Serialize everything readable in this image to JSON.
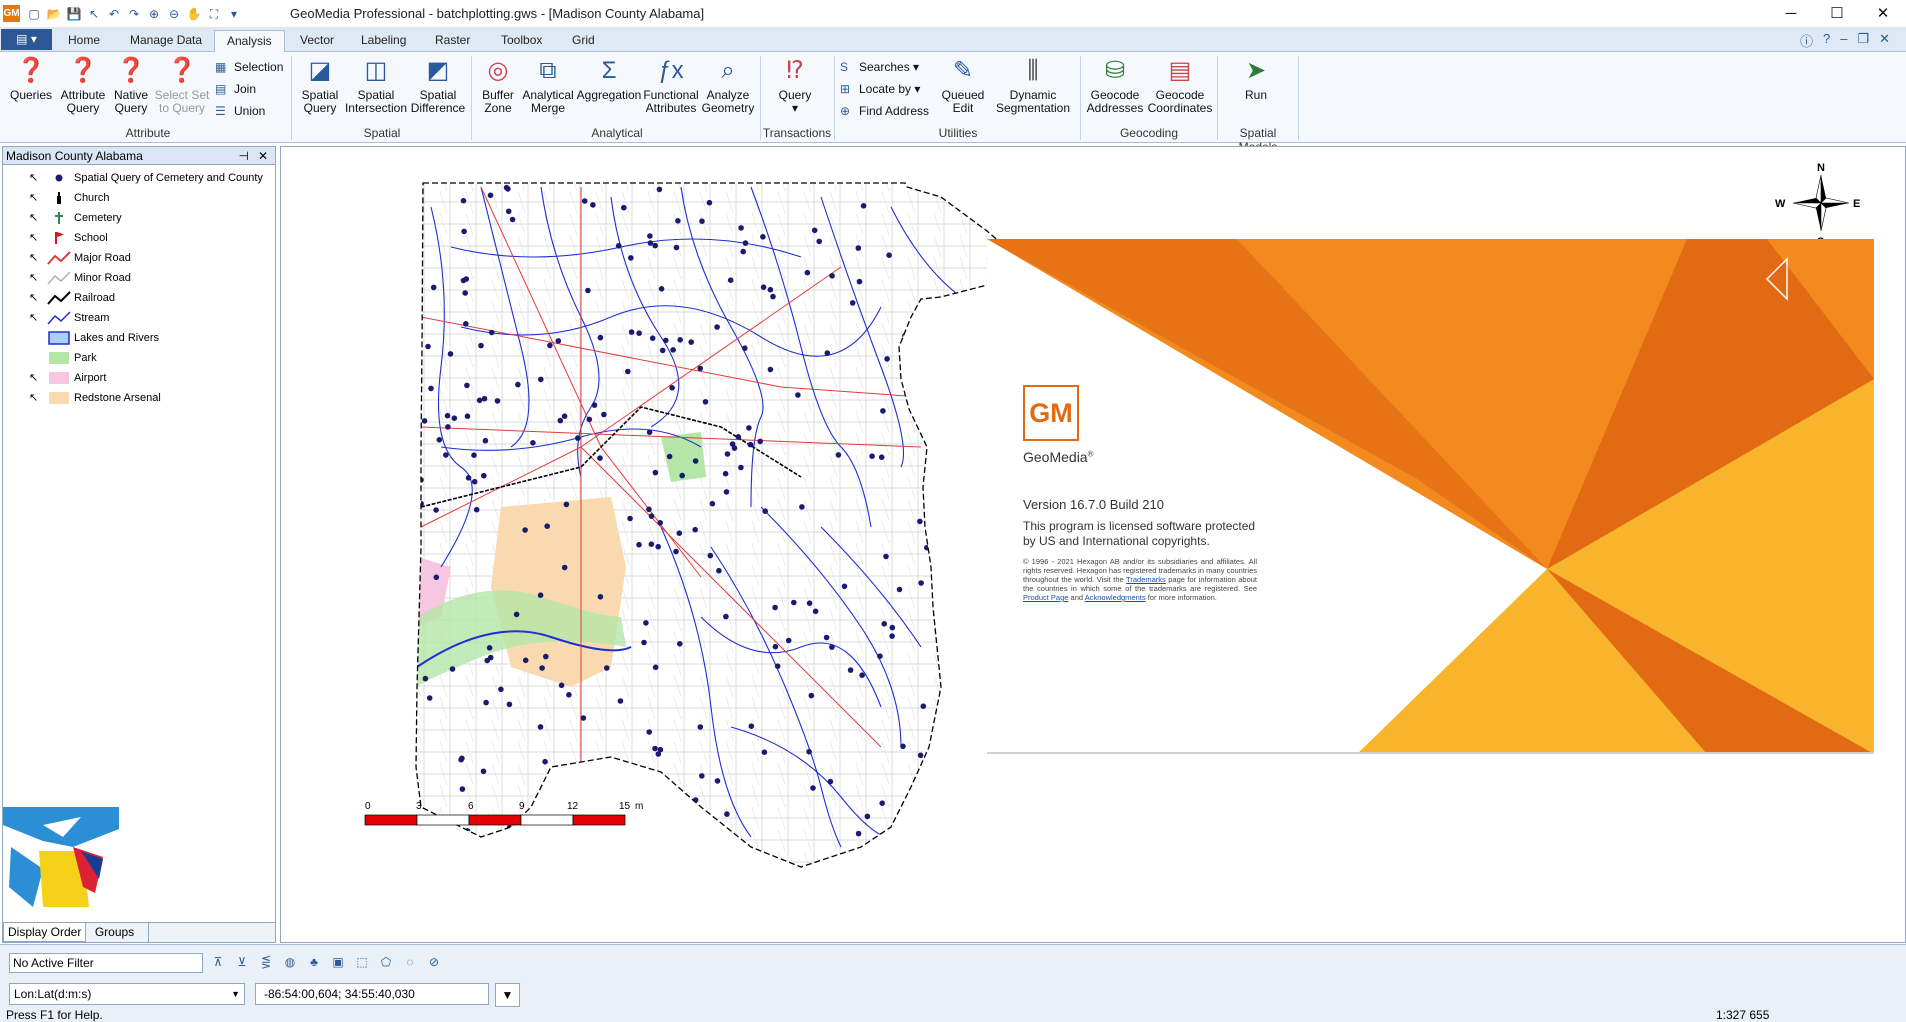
{
  "titlebar": {
    "app_logo": "GM",
    "title": "GeoMedia Professional - batchplotting.gws - [Madison County Alabama]",
    "minimize": "─",
    "maximize": "☐",
    "close": "✕"
  },
  "tabs": {
    "file": "▤ ▾",
    "items": [
      "Home",
      "Manage Data",
      "Analysis",
      "Vector",
      "Labeling",
      "Raster",
      "Toolbox",
      "Grid"
    ]
  },
  "ribbon": {
    "queries": "Queries",
    "attribute_query": [
      "Attribute",
      "Query"
    ],
    "native_query": [
      "Native",
      "Query"
    ],
    "select_set": [
      "Select Set",
      "to Query"
    ],
    "selection": "Selection",
    "join": "Join",
    "union": "Union",
    "spatial_query": [
      "Spatial",
      "Query"
    ],
    "spatial_intersection": [
      "Spatial",
      "Intersection"
    ],
    "spatial_difference": [
      "Spatial",
      "Difference"
    ],
    "buffer_zone": [
      "Buffer",
      "Zone"
    ],
    "analytical_merge": [
      "Analytical",
      "Merge"
    ],
    "aggregation": "Aggregation",
    "functional_attributes": [
      "Functional",
      "Attributes"
    ],
    "analyze_geometry": [
      "Analyze",
      "Geometry"
    ],
    "query": "Query",
    "searches": "Searches ▾",
    "locate_by": "Locate by ▾",
    "find_address": "Find Address",
    "queued_edit": [
      "Queued",
      "Edit"
    ],
    "dynamic_segmentation": [
      "Dynamic",
      "Segmentation"
    ],
    "geocode_addresses": [
      "Geocode",
      "Addresses"
    ],
    "geocode_coordinates": [
      "Geocode",
      "Coordinates"
    ],
    "run": "Run",
    "groups": {
      "attribute": "Attribute",
      "spatial": "Spatial",
      "analytical": "Analytical",
      "transactions": "Transactions",
      "utilities": "Utilities",
      "geocoding": "Geocoding",
      "spatial_models": "Spatial Models"
    }
  },
  "legend_panel": {
    "title": "Madison County Alabama",
    "items": [
      {
        "label": "Spatial Query of Cemetery and County",
        "symbol": "dot",
        "color": "#1a1a6e"
      },
      {
        "label": "Church",
        "symbol": "church",
        "color": "#000000"
      },
      {
        "label": "Cemetery",
        "symbol": "cross",
        "color": "#2e8b57"
      },
      {
        "label": "School",
        "symbol": "flag",
        "color": "#dd1111"
      },
      {
        "label": "Major Road",
        "symbol": "line",
        "color": "#e23b3b"
      },
      {
        "label": "Minor Road",
        "symbol": "line",
        "color": "#b0b0b0"
      },
      {
        "label": "Railroad",
        "symbol": "line",
        "color": "#000000"
      },
      {
        "label": "Stream",
        "symbol": "line",
        "color": "#1f2fd0"
      },
      {
        "label": "Lakes and Rivers",
        "symbol": "area",
        "color": "#a9d0f5"
      },
      {
        "label": "Park",
        "symbol": "area",
        "color": "#b4e6a8"
      },
      {
        "label": "Airport",
        "symbol": "area",
        "color": "#f7c6e0"
      },
      {
        "label": "Redstone Arsenal",
        "symbol": "area",
        "color": "#f8d9b0"
      }
    ],
    "tab_display_order": "Display Order",
    "tab_groups": "Groups"
  },
  "map": {
    "scale_labels": [
      "0",
      "3",
      "6",
      "9",
      "12",
      "15",
      "m"
    ],
    "compass": {
      "n": "N",
      "s": "S",
      "e": "E",
      "w": "W"
    }
  },
  "splash": {
    "logo": "GM",
    "product": "GeoMedia",
    "version": "Version 16.7.0 Build 210",
    "license": "This program is licensed software protected by US and International copyrights.",
    "copyright_before_tm": "© 1996 - 2021 Hexagon AB and/or its subsidiaries and affiliates. All rights reserved. Hexagon has registered trademarks in many countries throughout the world. Visit the",
    "trademarks_link": "Trademarks",
    "copyright_mid": "page for information about the countries in which some of the trademarks are registered. See",
    "product_link": "Product Page",
    "and_text": "and",
    "ack_link": "Acknowledgments",
    "copyright_end": "for more information.",
    "colors": {
      "orange": "#f28a1e",
      "deep": "#e26a12",
      "yellow": "#f7b42c"
    }
  },
  "status": {
    "filter": "No Active Filter",
    "coord_system": "Lon:Lat(d:m:s)",
    "coordinates": "-86:54:00,604; 34:55:40,030",
    "help": "Press F1 for Help.",
    "scale": "1:327 655"
  }
}
